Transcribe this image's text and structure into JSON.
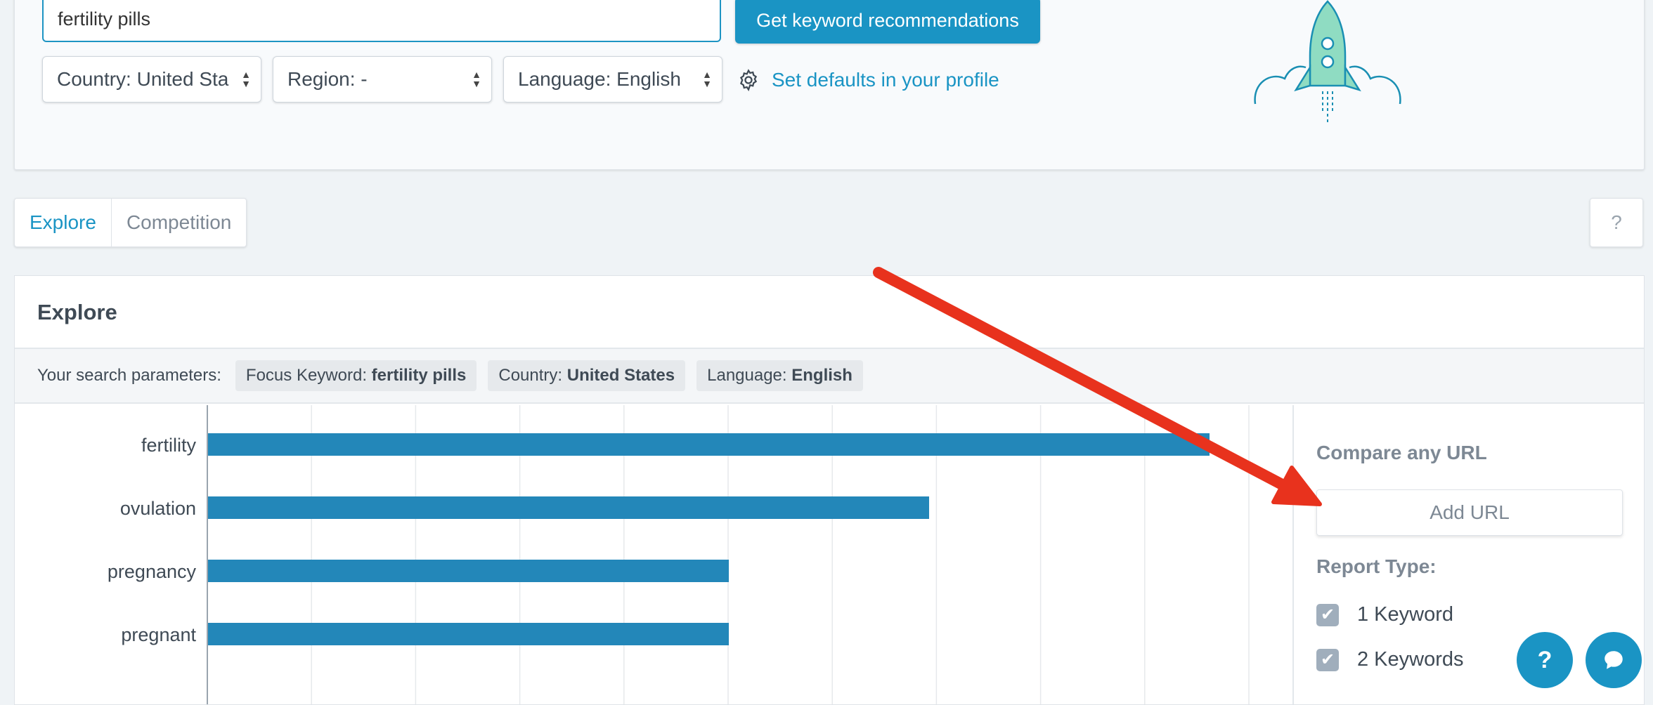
{
  "search": {
    "value": "fertility pills",
    "button_label": "Get keyword recommendations"
  },
  "filters": {
    "country": "Country: United Sta",
    "region": "Region: -",
    "language": "Language: English",
    "defaults_link": "Set defaults in your profile"
  },
  "tabs": [
    {
      "label": "Explore",
      "active": true
    },
    {
      "label": "Competition",
      "active": false
    }
  ],
  "help_label": "?",
  "explore": {
    "title": "Explore",
    "params_label": "Your search parameters:",
    "chips": [
      {
        "key": "Focus Keyword:",
        "value": "fertility pills"
      },
      {
        "key": "Country:",
        "value": "United States"
      },
      {
        "key": "Language:",
        "value": "English"
      }
    ]
  },
  "chart_data": {
    "type": "bar",
    "orientation": "horizontal",
    "categories": [
      "fertility",
      "ovulation",
      "pregnancy",
      "pregnant"
    ],
    "values": [
      100,
      72,
      52,
      52
    ],
    "xlim": [
      0,
      104
    ],
    "grid": true,
    "color": "#2387b9"
  },
  "sidebar": {
    "compare_heading": "Compare any URL",
    "url_placeholder": "Add URL",
    "report_heading": "Report Type:",
    "options": [
      {
        "label": "1 Keyword",
        "checked": true
      },
      {
        "label": "2 Keywords",
        "checked": true
      }
    ]
  },
  "fabs": {
    "help": "?",
    "chat_icon": "chat-bubble-icon"
  },
  "colors": {
    "accent": "#1a94c4",
    "annotation_arrow": "#e8321d"
  }
}
